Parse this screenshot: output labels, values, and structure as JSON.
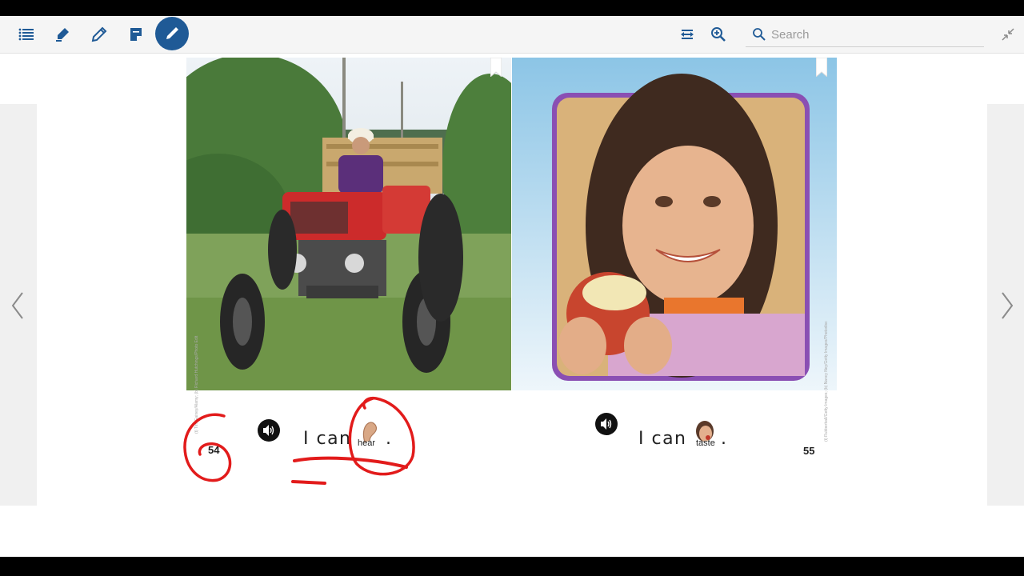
{
  "toolbar": {
    "icons": [
      "table-of-contents-icon",
      "highlighter-icon",
      "pen-icon",
      "note-icon",
      "draw-icon",
      "fit-width-icon",
      "zoom-in-icon",
      "exit-fullscreen-icon"
    ],
    "search_placeholder": "Search",
    "accent": "#1f5a96"
  },
  "navigation": {
    "prev_icon": "chevron-left-icon",
    "next_icon": "chevron-right-icon"
  },
  "pages": [
    {
      "page_number": "54",
      "sentence_prefix": "I can",
      "sentence_suffix": ".",
      "rebus_icon": "ear-icon",
      "rebus_word": "hear",
      "photo": "farmer-on-red-tractor-in-orchard",
      "credit": "(t) Tim Gainey/Alamy; (b) Richard Hutchings/Photo Edit"
    },
    {
      "page_number": "55",
      "sentence_prefix": "I can",
      "sentence_suffix": ".",
      "rebus_icon": "mouth-icon",
      "rebus_word": "taste",
      "photo": "girl-eating-apple",
      "credit": "(t) Rubberball/Getty Images; (b) Nancy Ney/Getty Images/Photodisc"
    }
  ],
  "annotations": {
    "ink_color": "#e21b1b"
  }
}
